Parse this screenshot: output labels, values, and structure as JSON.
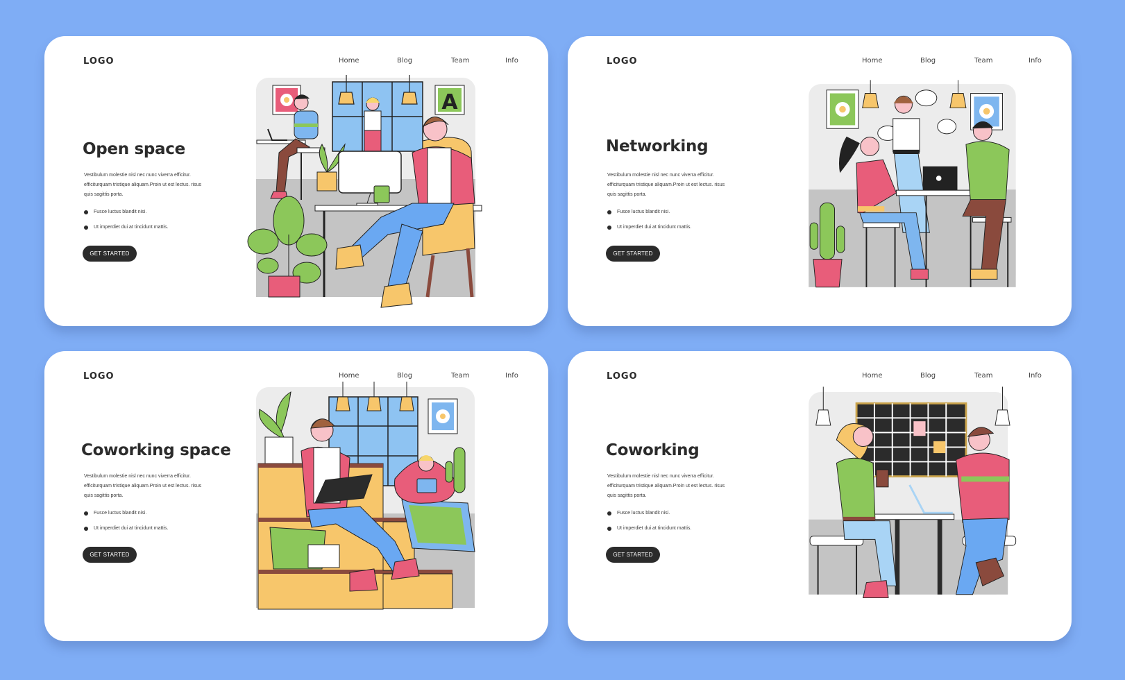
{
  "theme": {
    "background": "#7fadf5",
    "card": "#ffffff",
    "text_dark": "#2b2b2b",
    "button_bg": "#2b2b2b",
    "pink": "#e85d7a",
    "blue": "#6aa8f2",
    "light_blue": "#a9d4f5",
    "yellow": "#f7c66b",
    "green": "#8cc75a",
    "brown": "#8a4a3d",
    "gray_floor": "#c4c4c4",
    "gray_wall": "#ececec"
  },
  "cards": [
    {
      "logo": "LOGO",
      "nav": [
        "Home",
        "Blog",
        "Team",
        "Info"
      ],
      "title": "Open space",
      "description": "Vestibulum molestie nisl nec nunc viverra efficitur. efficiturquam tristique aliquam.Proin ut est lectus. risus quis sagittis porta.",
      "bullets": [
        "Fusce luctus blandit nisi.",
        "Ut imperdiet dui at tincidunt mattis."
      ],
      "cta": "GET STARTED",
      "illustration": "open-space-office-scene"
    },
    {
      "logo": "LOGO",
      "nav": [
        "Home",
        "Blog",
        "Team",
        "Info"
      ],
      "title": "Networking",
      "description": "Vestibulum molestie nisl nec nunc viverra efficitur. efficiturquam tristique aliquam.Proin ut est lectus. risus quis sagittis porta.",
      "bullets": [
        "Fusce luctus blandit nisi.",
        "Ut imperdiet dui at tincidunt mattis."
      ],
      "cta": "GET STARTED",
      "illustration": "networking-people-talking-scene"
    },
    {
      "logo": "LOGO",
      "nav": [
        "Home",
        "Blog",
        "Team",
        "Info"
      ],
      "title": "Coworking space",
      "description": "Vestibulum molestie nisl nec nunc viverra efficitur. efficiturquam tristique aliquam.Proin ut est lectus. risus quis sagittis porta.",
      "bullets": [
        "Fusce luctus blandit nisi.",
        "Ut imperdiet dui at tincidunt mattis."
      ],
      "cta": "GET STARTED",
      "illustration": "coworking-space-lounge-scene"
    },
    {
      "logo": "LOGO",
      "nav": [
        "Home",
        "Blog",
        "Team",
        "Info"
      ],
      "title": "Coworking",
      "description": "Vestibulum molestie nisl nec nunc viverra efficitur. efficiturquam tristique aliquam.Proin ut est lectus. risus quis sagittis porta.",
      "bullets": [
        "Fusce luctus blandit nisi.",
        "Ut imperdiet dui at tincidunt mattis."
      ],
      "cta": "GET STARTED",
      "illustration": "coworking-calendar-board-scene"
    }
  ]
}
